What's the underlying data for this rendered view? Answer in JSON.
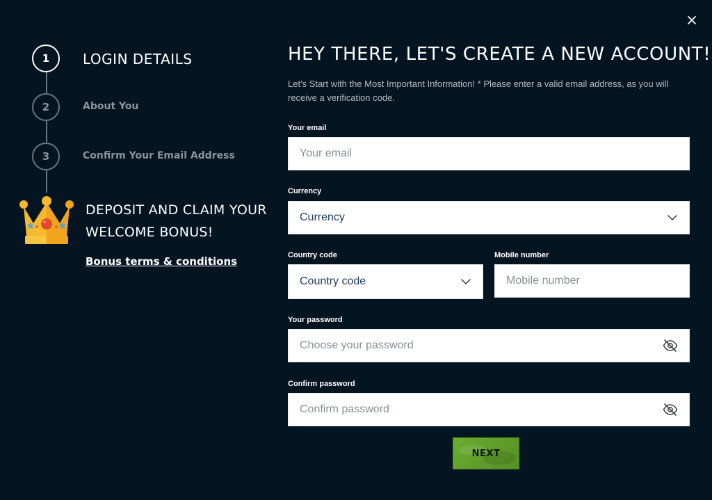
{
  "steps": [
    {
      "number": "1",
      "label": "LOGIN DETAILS",
      "active": true
    },
    {
      "number": "2",
      "label": "About You",
      "active": false
    },
    {
      "number": "3",
      "label": "Confirm Your Email Address",
      "active": false
    }
  ],
  "bonus": {
    "line1": "DEPOSIT AND CLAIM YOUR",
    "line2": "WELCOME BONUS!",
    "link": "Bonus terms & conditions"
  },
  "form": {
    "title": "HEY THERE, LET'S CREATE A NEW ACCOUNT!",
    "subtitle": "Let's Start with the Most Important Information! * Please enter a valid email address, as you will receive a verification code.",
    "email": {
      "label": "Your email",
      "placeholder": "Your email"
    },
    "currency": {
      "label": "Currency",
      "value": "Currency"
    },
    "country_code": {
      "label": "Country code",
      "value": "Country code"
    },
    "mobile": {
      "label": "Mobile number",
      "placeholder": "Mobile number"
    },
    "password": {
      "label": "Your password",
      "placeholder": "Choose your password"
    },
    "confirm_password": {
      "label": "Confirm password",
      "placeholder": "Confirm password"
    },
    "next_label": "NEXT"
  },
  "icons": {
    "close": "close-icon",
    "chevron": "chevron-down-icon",
    "eye_off": "eye-off-icon",
    "crown": "crown-icon"
  },
  "colors": {
    "background": "#051421",
    "accent_green": "#5f9e2a",
    "crown_gold": "#f5b82e",
    "step_inactive": "#6b7680"
  }
}
